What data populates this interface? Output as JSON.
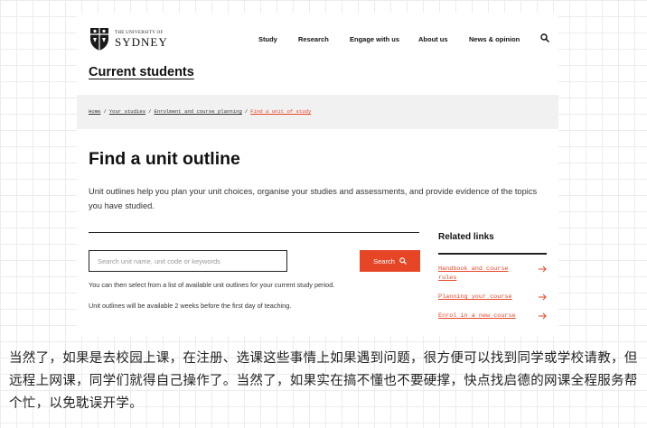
{
  "logo": {
    "small": "THE UNIVERSITY OF",
    "big": "SYDNEY"
  },
  "nav": [
    "Study",
    "Research",
    "Engage with us",
    "About us",
    "News & opinion"
  ],
  "section_title": "Current students",
  "breadcrumb": {
    "home": "Home",
    "studies": "Your studies",
    "enrolment": "Enrolment and course planning",
    "current": "Find a unit of study",
    "separator": "/"
  },
  "page_title": "Find a unit outline",
  "lead": "Unit outlines help you plan your unit choices, organise your studies and assessments, and provide evidence of the topics you have studied.",
  "search": {
    "placeholder": "Search unit name, unit code or keywords",
    "value": "",
    "button_label": "Search"
  },
  "notes": {
    "select": "You can then select from a list of available unit outlines for your current study period.",
    "available": "Unit outlines will be available 2 weeks before the first day of teaching."
  },
  "related": {
    "title": "Related links",
    "links": [
      "Handbook and course rules",
      "Planning your course",
      "Enrol in a new course"
    ]
  },
  "caption": "当然了，如果是去校园上课，在注册、选课这些事情上如果遇到问题，很方便可以找到同学或学校请教，但远程上网课，同学们就得自己操作了。当然了，如果实在搞不懂也不要硬撑，快点找启德的网课全程服务帮个忙，以免耽误开学。",
  "icons": {
    "crest": "university-crest-icon",
    "search": "search-icon",
    "arrow": "arrow-right-icon"
  },
  "colors": {
    "accent": "#e64626",
    "text": "#111111",
    "crumb_bg": "#f1f1f1"
  }
}
